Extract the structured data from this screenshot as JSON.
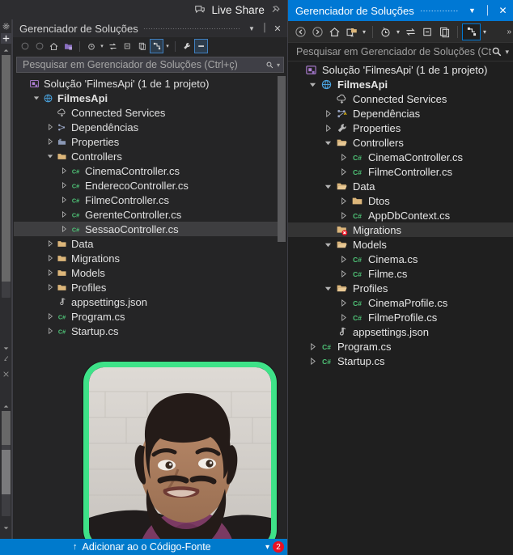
{
  "live_share": {
    "label": "Live Share",
    "icon": "live-share-icon",
    "pin_icon": "pin-icon"
  },
  "left_panel": {
    "title": "Gerenciador de Soluções",
    "title_buttons": [
      {
        "name": "window-dropdown-button",
        "glyph": "▼"
      },
      {
        "name": "pin-button",
        "glyph": "⏐"
      },
      {
        "name": "close-button",
        "glyph": "✕"
      }
    ],
    "toolbar": [
      {
        "name": "back-icon",
        "glyph": "○"
      },
      {
        "name": "forward-icon",
        "glyph": "○"
      },
      {
        "name": "home-icon",
        "glyph": "⌂"
      },
      {
        "name": "new-folder-icon",
        "glyph": "◰"
      },
      {
        "name": "pending-changes-icon",
        "glyph": "◴"
      },
      {
        "name": "sync-icon",
        "glyph": "⇆"
      },
      {
        "name": "collapse-all-icon",
        "glyph": "⧉"
      },
      {
        "name": "show-all-files-icon",
        "glyph": "❐"
      },
      {
        "name": "properties-view-icon",
        "glyph": "⤡"
      },
      {
        "name": "wrench-icon",
        "glyph": "ὒ7"
      },
      {
        "name": "properties-window-icon",
        "glyph": "▬"
      }
    ],
    "search": {
      "placeholder": "Pesquisar em Gerenciador de Soluções (Ctrl+ç)",
      "icon": "search-icon",
      "caret": "▾"
    },
    "tree": [
      {
        "label": "Solução 'FilmesApi' (1 de 1 projeto)",
        "indent": 0,
        "arrow": "none",
        "icon": "solution-icon",
        "bold": false,
        "selected": false
      },
      {
        "label": "FilmesApi",
        "indent": 1,
        "arrow": "expanded",
        "icon": "project-icon",
        "bold": true,
        "selected": false
      },
      {
        "label": "Connected Services",
        "indent": 2,
        "arrow": "none",
        "icon": "connected-services-icon",
        "bold": false,
        "selected": false
      },
      {
        "label": "Dependências",
        "indent": 2,
        "arrow": "collapsed",
        "icon": "dependencies-icon",
        "bold": false,
        "selected": false
      },
      {
        "label": "Properties",
        "indent": 2,
        "arrow": "collapsed",
        "icon": "properties-icon",
        "bold": false,
        "selected": false
      },
      {
        "label": "Controllers",
        "indent": 2,
        "arrow": "expanded",
        "icon": "folder-icon",
        "bold": false,
        "selected": false
      },
      {
        "label": "CinemaController.cs",
        "indent": 3,
        "arrow": "collapsed",
        "icon": "csharp-icon",
        "bold": false,
        "selected": false
      },
      {
        "label": "EnderecoController.cs",
        "indent": 3,
        "arrow": "collapsed",
        "icon": "csharp-icon",
        "bold": false,
        "selected": false
      },
      {
        "label": "FilmeController.cs",
        "indent": 3,
        "arrow": "collapsed",
        "icon": "csharp-icon",
        "bold": false,
        "selected": false
      },
      {
        "label": "GerenteController.cs",
        "indent": 3,
        "arrow": "collapsed",
        "icon": "csharp-icon",
        "bold": false,
        "selected": false
      },
      {
        "label": "SessaoController.cs",
        "indent": 3,
        "arrow": "collapsed",
        "icon": "csharp-icon",
        "bold": false,
        "selected": true
      },
      {
        "label": "Data",
        "indent": 2,
        "arrow": "collapsed",
        "icon": "folder-icon",
        "bold": false,
        "selected": false
      },
      {
        "label": "Migrations",
        "indent": 2,
        "arrow": "collapsed",
        "icon": "folder-icon",
        "bold": false,
        "selected": false
      },
      {
        "label": "Models",
        "indent": 2,
        "arrow": "collapsed",
        "icon": "folder-icon",
        "bold": false,
        "selected": false
      },
      {
        "label": "Profiles",
        "indent": 2,
        "arrow": "collapsed",
        "icon": "folder-icon",
        "bold": false,
        "selected": false
      },
      {
        "label": "appsettings.json",
        "indent": 2,
        "arrow": "none",
        "icon": "json-icon",
        "bold": false,
        "selected": false
      },
      {
        "label": "Program.cs",
        "indent": 2,
        "arrow": "collapsed",
        "icon": "csharp-icon",
        "bold": false,
        "selected": false
      },
      {
        "label": "Startup.cs",
        "indent": 2,
        "arrow": "collapsed",
        "icon": "csharp-icon",
        "bold": false,
        "selected": false
      }
    ]
  },
  "right_panel": {
    "title": "Gerenciador de Soluções",
    "title_buttons": [
      {
        "name": "window-dropdown-button",
        "glyph": "▼"
      },
      {
        "name": "pin-button",
        "glyph": "⏐"
      },
      {
        "name": "close-button",
        "glyph": "✕"
      }
    ],
    "toolbar": [
      {
        "name": "back-icon",
        "glyph": "←"
      },
      {
        "name": "forward-icon",
        "glyph": "→"
      },
      {
        "name": "home-icon",
        "glyph": "⌂"
      },
      {
        "name": "new-folder-icon",
        "glyph": "◰"
      },
      {
        "name": "pending-changes-icon",
        "glyph": "◴"
      },
      {
        "name": "sync-with-active-document-icon",
        "glyph": "⇆"
      },
      {
        "name": "collapse-all-icon",
        "glyph": "⧉"
      },
      {
        "name": "show-all-files-icon",
        "glyph": "❐"
      },
      {
        "name": "properties-view-icon",
        "glyph": "⤡"
      }
    ],
    "overflow_glyph": "»",
    "search": {
      "placeholder": "Pesquisar em Gerenciador de Soluções (Ctrl+",
      "icon": "search-icon",
      "caret": "▾"
    },
    "tree": [
      {
        "label": "Solução 'FilmesApi' (1 de 1 projeto)",
        "indent": 0,
        "arrow": "none",
        "icon": "solution-icon",
        "bold": false,
        "selected": false
      },
      {
        "label": "FilmesApi",
        "indent": 1,
        "arrow": "expanded",
        "icon": "project-icon",
        "bold": true,
        "selected": false
      },
      {
        "label": "Connected Services",
        "indent": 2,
        "arrow": "none",
        "icon": "connected-services-icon",
        "bold": false,
        "selected": false
      },
      {
        "label": "Dependências",
        "indent": 2,
        "arrow": "collapsed",
        "icon": "dependencies-warning-icon",
        "bold": false,
        "selected": false
      },
      {
        "label": "Properties",
        "indent": 2,
        "arrow": "collapsed",
        "icon": "wrench-icon",
        "bold": false,
        "selected": false
      },
      {
        "label": "Controllers",
        "indent": 2,
        "arrow": "expanded",
        "icon": "folder-open-icon",
        "bold": false,
        "selected": false
      },
      {
        "label": "CinemaController.cs",
        "indent": 3,
        "arrow": "collapsed",
        "icon": "csharp-icon",
        "bold": false,
        "selected": false
      },
      {
        "label": "FilmeController.cs",
        "indent": 3,
        "arrow": "collapsed",
        "icon": "csharp-icon",
        "bold": false,
        "selected": false
      },
      {
        "label": "Data",
        "indent": 2,
        "arrow": "expanded",
        "icon": "folder-open-icon",
        "bold": false,
        "selected": false
      },
      {
        "label": "Dtos",
        "indent": 3,
        "arrow": "collapsed",
        "icon": "folder-icon",
        "bold": false,
        "selected": false
      },
      {
        "label": "AppDbContext.cs",
        "indent": 3,
        "arrow": "collapsed",
        "icon": "csharp-icon",
        "bold": false,
        "selected": false
      },
      {
        "label": "Migrations",
        "indent": 2,
        "arrow": "none",
        "icon": "folder-error-icon",
        "bold": false,
        "selected": true
      },
      {
        "label": "Models",
        "indent": 2,
        "arrow": "expanded",
        "icon": "folder-open-icon",
        "bold": false,
        "selected": false
      },
      {
        "label": "Cinema.cs",
        "indent": 3,
        "arrow": "collapsed",
        "icon": "csharp-icon",
        "bold": false,
        "selected": false
      },
      {
        "label": "Filme.cs",
        "indent": 3,
        "arrow": "collapsed",
        "icon": "csharp-icon",
        "bold": false,
        "selected": false
      },
      {
        "label": "Profiles",
        "indent": 2,
        "arrow": "expanded",
        "icon": "folder-open-icon",
        "bold": false,
        "selected": false
      },
      {
        "label": "CinemaProfile.cs",
        "indent": 3,
        "arrow": "collapsed",
        "icon": "csharp-icon",
        "bold": false,
        "selected": false
      },
      {
        "label": "FilmeProfile.cs",
        "indent": 3,
        "arrow": "collapsed",
        "icon": "csharp-icon",
        "bold": false,
        "selected": false
      },
      {
        "label": "appsettings.json",
        "indent": 2,
        "arrow": "none",
        "icon": "json-icon",
        "bold": false,
        "selected": false
      },
      {
        "label": "Program.cs",
        "indent": 1,
        "arrow": "collapsed",
        "icon": "csharp-icon",
        "bold": false,
        "selected": false
      },
      {
        "label": "Startup.cs",
        "indent": 1,
        "arrow": "collapsed",
        "icon": "csharp-icon",
        "bold": false,
        "selected": false
      }
    ]
  },
  "status_bar": {
    "arrow_glyph": "↑",
    "text": "Adicionar ao    o Código-Fonte",
    "caret_glyph": "▾",
    "badge_count": "2"
  },
  "webcam": {
    "name": "webcam-overlay",
    "border_color": "#3ee288"
  },
  "colors": {
    "left_bg": "#252526",
    "right_bg": "#1f1f1f",
    "accent_blue": "#0078d4",
    "status_blue": "#007acc",
    "selection_left": "#3e3e40",
    "selection_right": "#343434",
    "folder_gold": "#dcb67a",
    "csharp_green": "#4ec276",
    "error_red": "#e81123"
  }
}
